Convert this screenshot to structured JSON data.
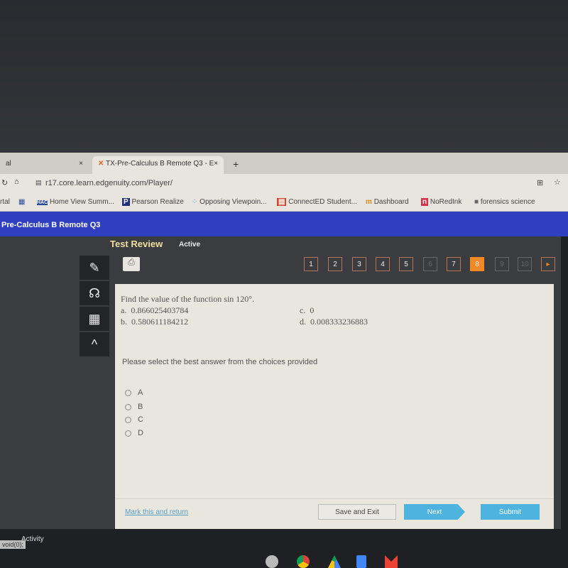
{
  "browser": {
    "tabs": [
      {
        "label": "al"
      },
      {
        "label": "TX-Pre-Calculus B Remote Q3 - E"
      }
    ],
    "new_tab": "+",
    "url": "r17.core.learn.edgenuity.com/Player/",
    "bookmarks": [
      "rtal",
      "Home View Summ...",
      "Pearson Realize",
      "Opposing Viewpoin...",
      "ConnectED Student...",
      "Dashboard",
      "NoRedInk",
      "forensics science"
    ]
  },
  "course_title": "Pre-Calculus B Remote Q3",
  "header": {
    "title": "Test Review",
    "status": "Active"
  },
  "pagination": {
    "pages": [
      "1",
      "2",
      "3",
      "4",
      "5",
      "6",
      "7",
      "8",
      "9",
      "10"
    ],
    "current": "8",
    "next": "▸"
  },
  "question": {
    "prompt": "Find the value of the function sin 120°.",
    "choices": [
      {
        "letter": "a.",
        "value": "0.866025403784"
      },
      {
        "letter": "b.",
        "value": "0.580611184212"
      },
      {
        "letter": "c.",
        "value": "0"
      },
      {
        "letter": "d.",
        "value": "0.008333236883"
      }
    ],
    "instruction": "Please select the best answer from the choices provided",
    "options": [
      "A",
      "B",
      "C",
      "D"
    ]
  },
  "footer": {
    "mark": "Mark this and return",
    "save": "Save and Exit",
    "next": "Next",
    "submit": "Submit"
  },
  "bottom": {
    "activity": "Activity",
    "tooltip": "void(0);"
  },
  "colors": {
    "brand_blue": "#2f3fc0",
    "current_page": "#f08a24",
    "button_blue": "#4fb3e0"
  }
}
